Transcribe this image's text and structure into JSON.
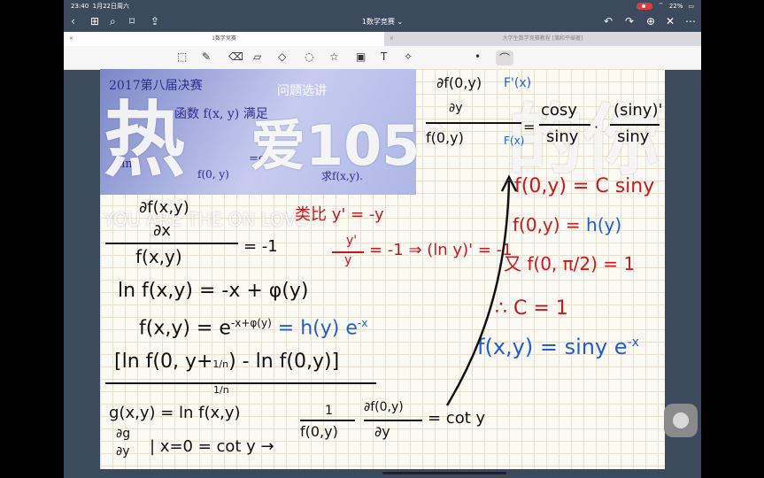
{
  "status": {
    "time": "23:40",
    "date": "1月22日周六",
    "wifi": "⌔",
    "battery": "22%"
  },
  "toolbar": {
    "title": "1数学竞赛",
    "chevron": "⌄"
  },
  "tabs": {
    "active": "1数学竞赛",
    "inactive": "大学生数学竞赛教程 [蒲和平编著]",
    "close": "×"
  },
  "photo": {
    "line1": "2017第八届决赛",
    "line2": "函数 f(x, y) 满足",
    "line3": "lim",
    "line4": "f(0, y)",
    "line5": "=e",
    "line6": "求f(x,y).",
    "line7": "问题选讲"
  },
  "watermark": {
    "big1": "热",
    "big2": "爱105°",
    "big3": "的你",
    "sub": "YOU ARE THE ON LOVE"
  },
  "notes": {
    "n1": "∂f(x,y)",
    "n2": "∂x",
    "n3": "f(x,y)",
    "n4": "= -1",
    "n5": "ln f(x,y)  = -x + φ(y)",
    "n6": "f(x,y)  = e",
    "n6exp": "-x+φ(y)",
    "n6b": "= h(y) e",
    "n6bexp": "-x",
    "n7": "[ln f(0, y+",
    "n7frac": "1/n",
    "n7b": ") - ln f(0,y)]",
    "n8exp": "1/n",
    "n9": "g(x,y) = ln f(x,y)",
    "n10": "∂g",
    "n11": "∂y",
    "n12": "| x=0  = cot y  →",
    "n13": "1",
    "n14": "f(0,y)",
    "n15": "∂f(0,y)",
    "n16": "∂y",
    "n17": "= cot y"
  },
  "red": {
    "r1": "类比 y' = -y",
    "r2": "y'",
    "r3": "y",
    "r4": "= -1 ⇒ (ln y)' = -1",
    "r5": "f(0,y) = C siny",
    "r6": "f(0,y) =",
    "r6b": "h(y)",
    "r7": "又 f(0, π/2) = 1",
    "r8": "∴ C = 1",
    "r9": "F'(x)",
    "r10": "F(x)",
    "top1": "∂f(0,y)",
    "top2": "∂y",
    "top3": "f(0,y)",
    "top4": "cosy",
    "top5": "siny",
    "top6": "(siny)'",
    "top7": "siny",
    "topeq": "=",
    "topdot": "·"
  },
  "blue": {
    "b1": "f(x,y) = siny e",
    "b1exp": "-x"
  },
  "icons": [
    "back",
    "grid",
    "search",
    "bookmark",
    "share",
    "undo",
    "redo",
    "add-page",
    "close",
    "more"
  ]
}
